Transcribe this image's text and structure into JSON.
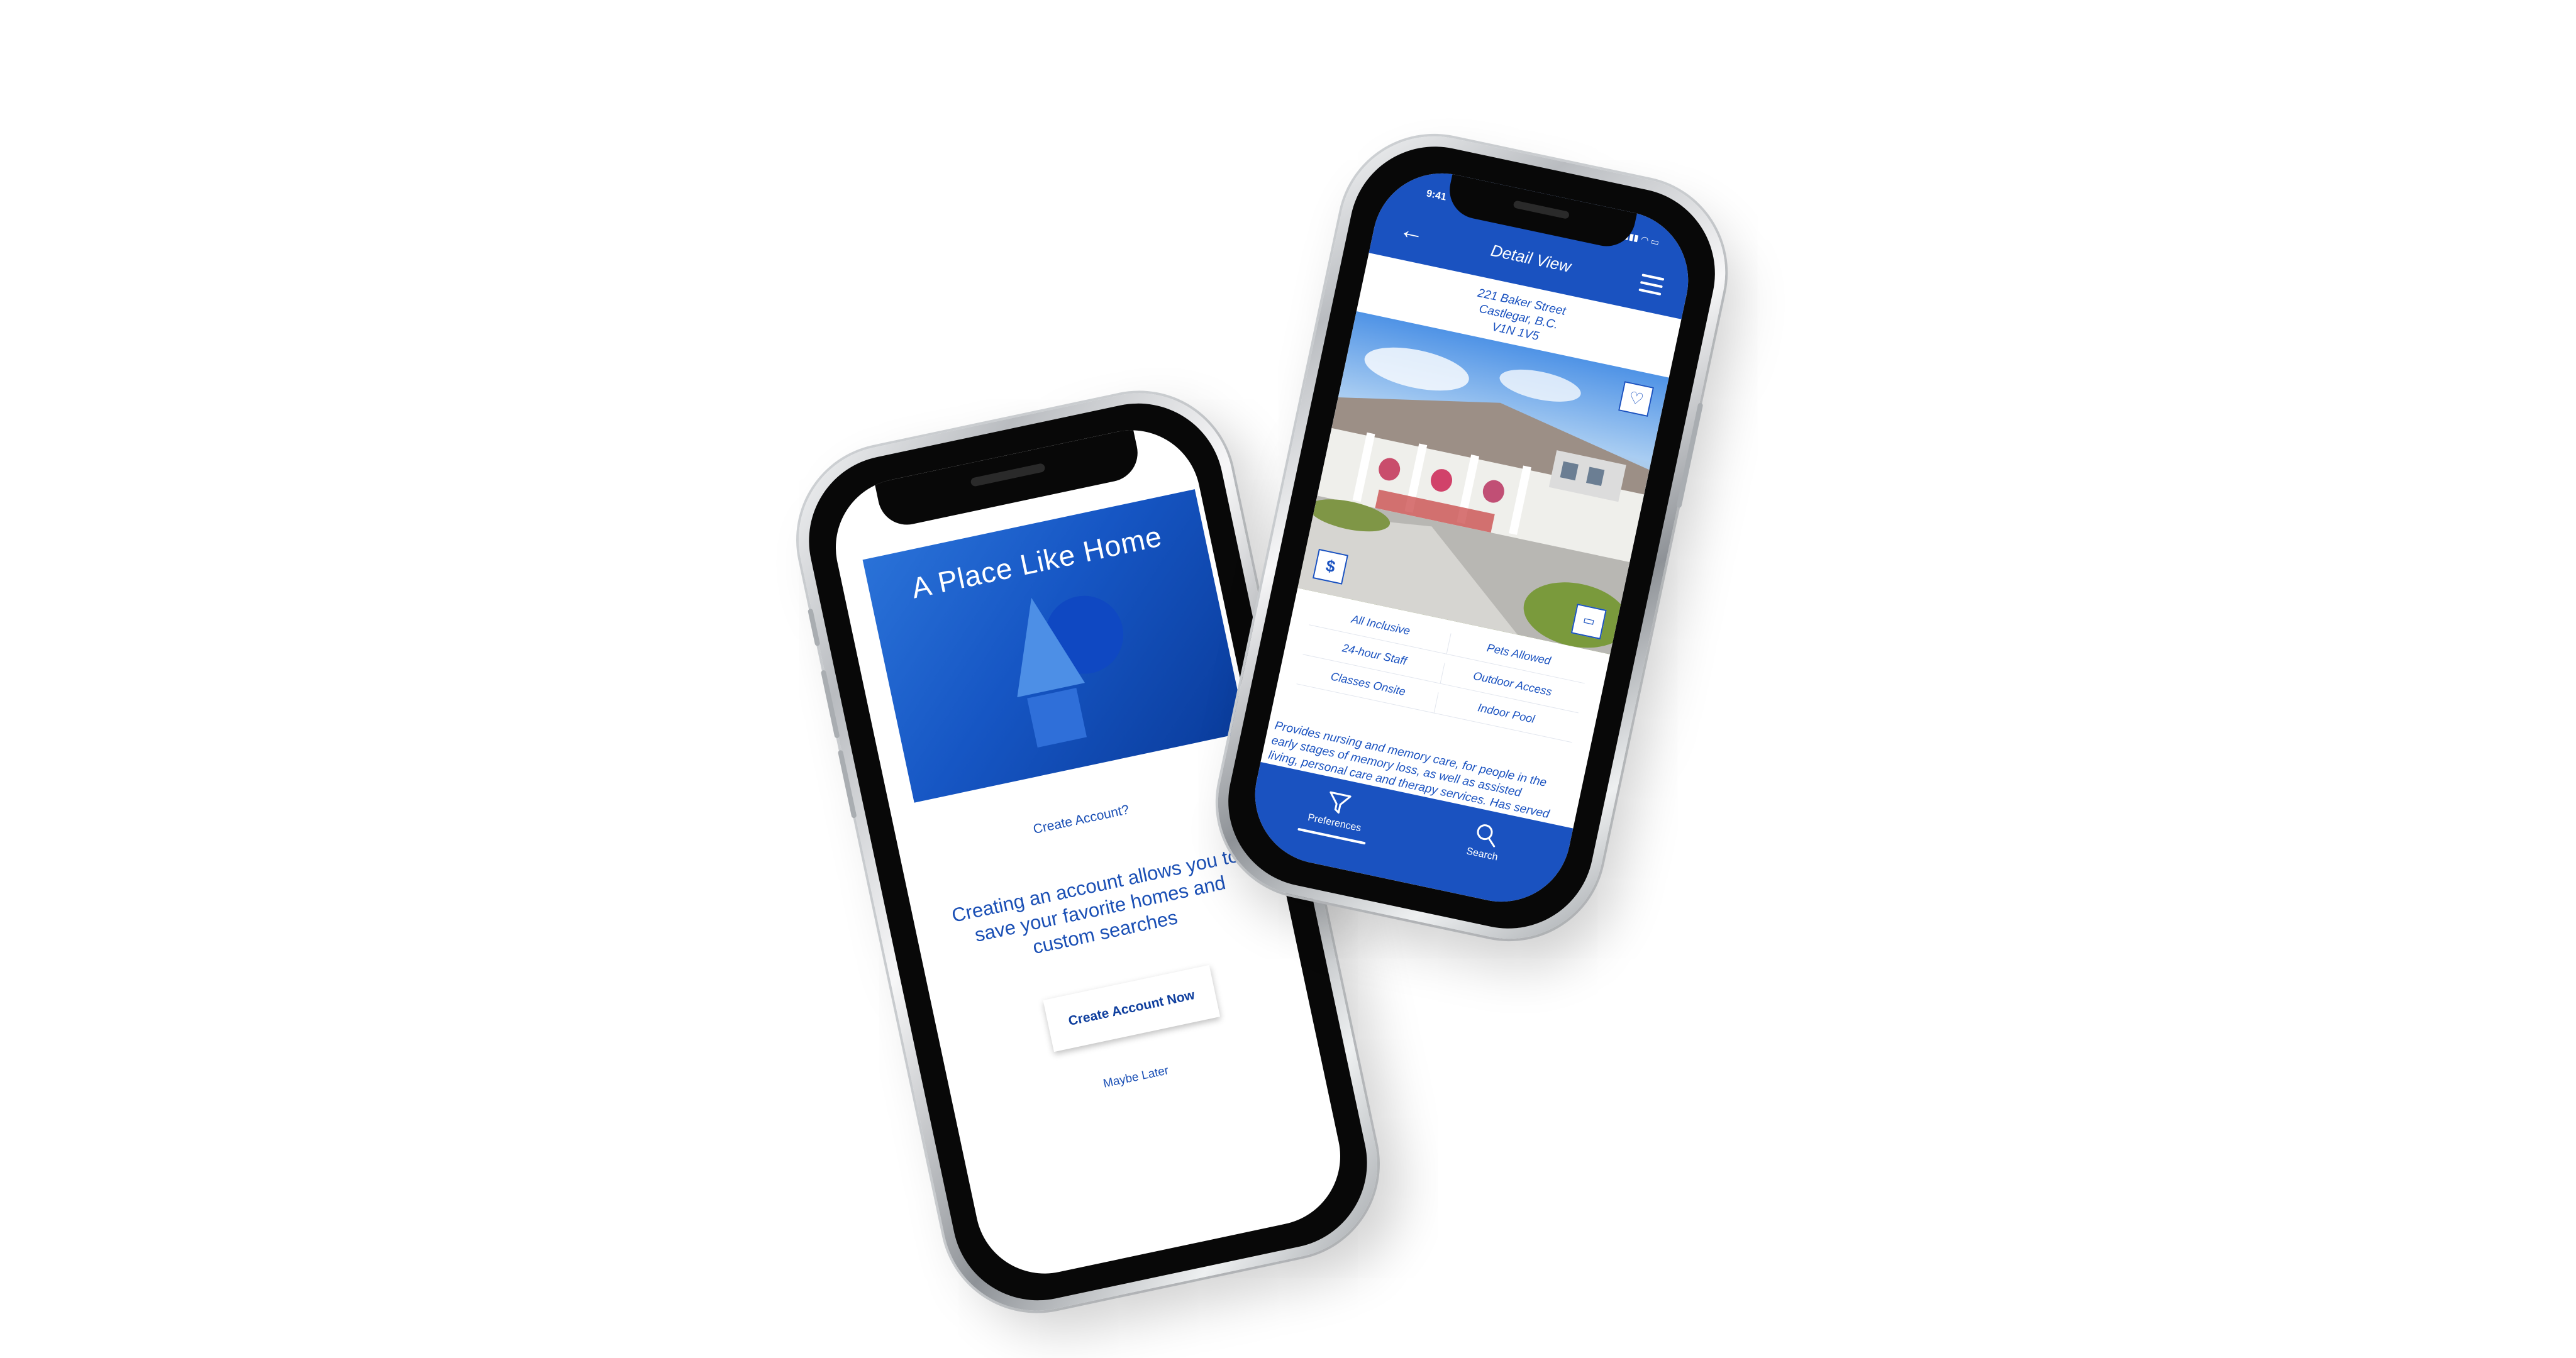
{
  "create_account_screen": {
    "hero_title": "A Place Like Home",
    "question": "Create Account?",
    "description": "Creating an account allows you to save your favorite homes and custom searches",
    "create_button_label": "Create Account Now",
    "maybe_later_label": "Maybe Later",
    "colors": {
      "brand_blue": "#1656c4",
      "accent_light_blue": "#4d8fe6"
    }
  },
  "detail_screen": {
    "status_time": "9:41",
    "header_title": "Detail View",
    "address": {
      "street": "221 Baker Street",
      "city": "Castlegar, B.C.",
      "postal": "V1N 1V5"
    },
    "amenities": [
      "All Inclusive",
      "Pets Allowed",
      "24-hour Staff",
      "Outdoor Access",
      "Classes Onsite",
      "Indoor Pool"
    ],
    "description": "Provides nursing and memory care, for people in the early stages of memory loss, as well as assisted living, personal care and therapy services. Has served the neighborhood for years. Numerous employees",
    "tabs": [
      {
        "label": "Preferences",
        "icon": "filter-icon",
        "active": true
      },
      {
        "label": "Search",
        "icon": "search-icon",
        "active": false
      }
    ],
    "icons": {
      "back": "back-arrow-icon",
      "menu": "hamburger-menu-icon",
      "favorite": "heart-icon",
      "price": "dollar-icon",
      "video": "video-icon"
    },
    "colors": {
      "header_blue": "#1a52c0"
    }
  }
}
